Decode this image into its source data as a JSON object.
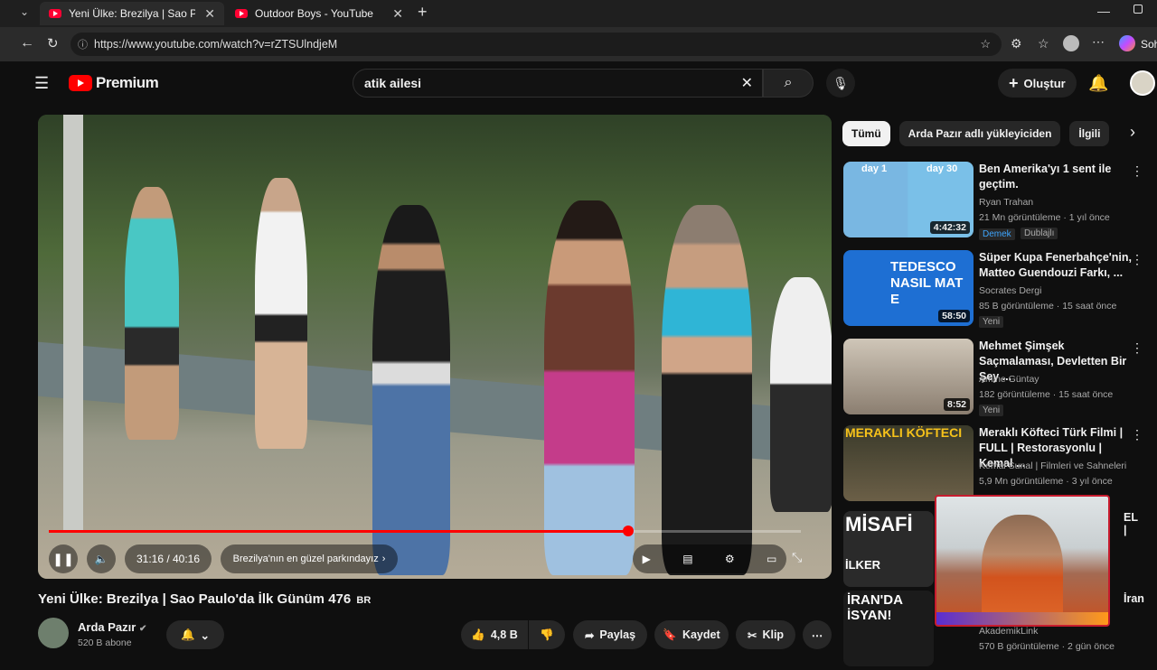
{
  "browser": {
    "tabs": [
      {
        "label": "Yeni Ülke: Brezilya | Sao Paulo"
      },
      {
        "label": "Outdoor Boys - YouTube"
      }
    ],
    "url": "https://www.youtube.com/watch?v=rZTSUlndjeM",
    "sidebar_label": "Soh"
  },
  "header": {
    "logo_text": "Premium",
    "search_value": "atik ailesi",
    "create_label": "Oluştur"
  },
  "player": {
    "time": "31:16 / 40:16",
    "chapter": "Brezilya'nın en güzel parkındayız",
    "progress": 0.77
  },
  "video": {
    "title": "Yeni Ülke: Brezilya | Sao Paulo'da İlk Günüm 476",
    "title_suffix": "BR",
    "channel": "Arda Pazır",
    "subscribers": "520 B abone",
    "likes": "4,8 B",
    "share_label": "Paylaş",
    "save_label": "Kaydet",
    "clip_label": "Klip"
  },
  "chips": [
    "Tümü",
    "Arda Pazır adlı yükleyiciden",
    "İlgili"
  ],
  "recommendations": [
    {
      "title": "Ben Amerika'yı 1 sent ile geçtim.",
      "channel": "Ryan Trahan",
      "meta": "21 Mn görüntüleme · 1 yıl önce",
      "badge": "Demek",
      "badge2": "Dublajlı",
      "duration": "4:42:32",
      "thumb_label_left": "day 1",
      "thumb_label_right": "day 30"
    },
    {
      "title": "Süper Kupa Fenerbahçe'nin, Matteo Guendouzi Farkı, ...",
      "channel": "Socrates Dergi",
      "meta": "85 B görüntüleme · 15 saat önce",
      "badge": "Yeni",
      "duration": "58:50",
      "thumb_label": "TEDESCO NASIL MAT E"
    },
    {
      "title": "Mehmet Şimşek Saçmalaması, Devletten Bir Şey ...",
      "channel": "Amine Güntay",
      "meta": "182 görüntüleme · 15 saat önce",
      "badge": "Yeni",
      "duration": "8:52"
    },
    {
      "title": "Meraklı Köfteci Türk Filmi | FULL | Restorasyonlu | Kemal ...",
      "channel": "Kemal Sunal | Filmleri ve Sahneleri",
      "meta": "5,9 Mn görüntüleme · 3 yıl önce",
      "thumb_label": "MERAKLI KÖFTECI"
    },
    {
      "title": "EL |",
      "channel": "",
      "meta": "",
      "thumb_label": "MİSAFİ",
      "thumb_label2": "İLKER"
    },
    {
      "title": "İran",
      "channel": "AkademikLink",
      "meta": "570 B görüntüleme · 2 gün önce",
      "thumb_label": "İRAN'DA İSYAN!"
    }
  ]
}
